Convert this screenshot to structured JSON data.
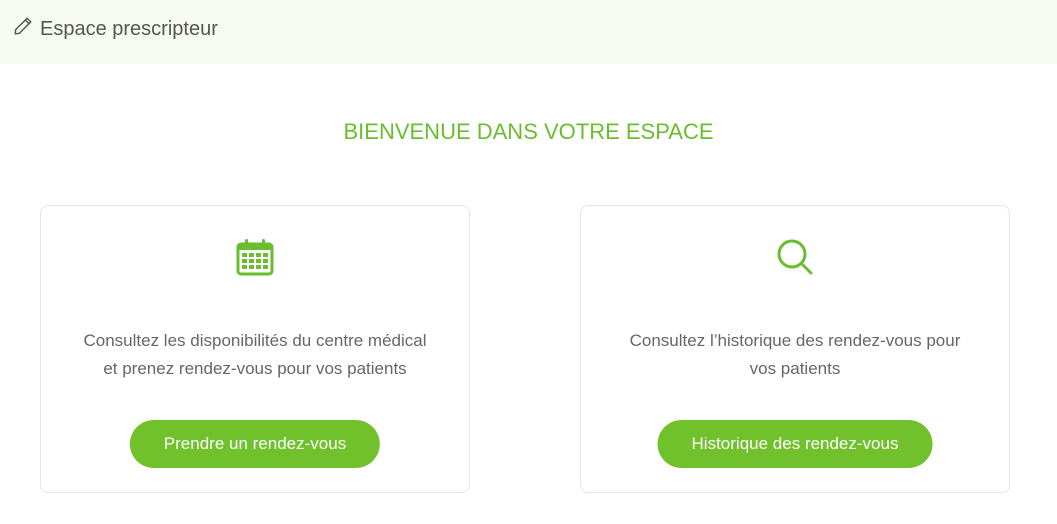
{
  "header": {
    "title": "Espace prescripteur",
    "icon": "pencil-icon"
  },
  "welcome": {
    "title": "BIENVENUE DANS VOTRE ESPACE"
  },
  "cards": [
    {
      "icon": "calendar-icon",
      "line1": "Consultez les disponibilités du centre médical",
      "line2": "et prenez rendez-vous pour vos patients",
      "button_label": "Prendre un rendez-vous"
    },
    {
      "icon": "search-icon",
      "line1": "Consultez l’historique des rendez-vous pour",
      "line2": "vos patients",
      "button_label": "Historique des rendez-vous"
    }
  ],
  "colors": {
    "accent": "#6abd2f",
    "button": "#70c12c",
    "header_bg": "#f7faf1",
    "text": "#666666"
  }
}
